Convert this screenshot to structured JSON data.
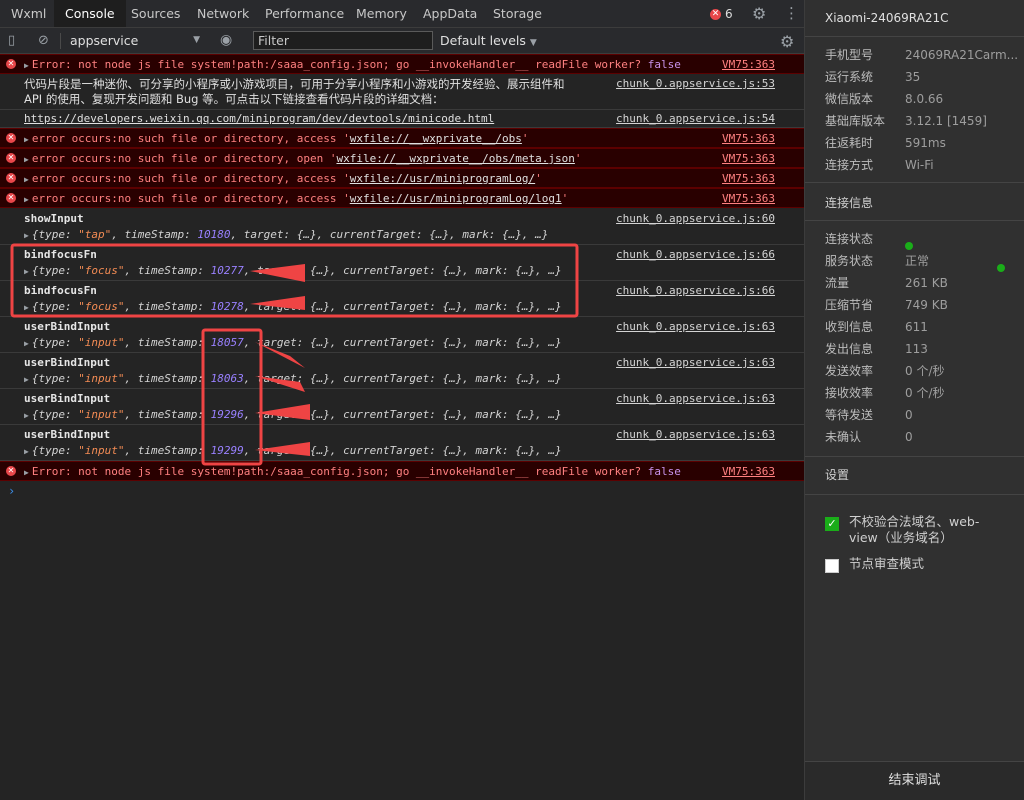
{
  "tabs": [
    "Wxml",
    "Console",
    "Sources",
    "Network",
    "Performance",
    "Memory",
    "AppData",
    "Storage"
  ],
  "error_count": "6",
  "toolbar": {
    "context": "appservice",
    "filter_placeholder": "Filter",
    "levels": "Default levels"
  },
  "logs": {
    "r0": {
      "text": "Error: not node js file system!path:/saaa_config.json; go __invokeHandler__ readFile worker?",
      "val": "false",
      "src": "VM75:363"
    },
    "r1": {
      "line1": "代码片段是一种迷你、可分享的小程序或小游戏项目，可用于分享小程序和小游戏的开发经验、展示组件和",
      "line2": "API 的使用、复现开发问题和 Bug 等。可点击以下链接查看代码片段的详细文档：",
      "src": "chunk_0.appservice.js:53"
    },
    "r2": {
      "link": "https://developers.weixin.qq.com/miniprogram/dev/devtools/minicode.html",
      "src": "chunk_0.appservice.js:54"
    },
    "r3": {
      "pre": "error occurs:no such file or directory, access '",
      "path": "wxfile://__wxprivate__/obs",
      "post": "'",
      "src": "VM75:363"
    },
    "r4": {
      "pre": "error occurs:no such file or directory, open '",
      "path": "wxfile://__wxprivate__/obs/meta.json",
      "post": "'",
      "src": "VM75:363"
    },
    "r5": {
      "pre": "error occurs:no such file or directory, access '",
      "path": "wxfile://usr/miniprogramLog/",
      "post": "'",
      "src": "VM75:363"
    },
    "r6": {
      "pre": "error occurs:no such file or directory, access '",
      "path": "wxfile://usr/miniprogramLog/log1",
      "post": "'",
      "src": "VM75:363"
    },
    "r7": {
      "label": "showInput",
      "type": "\"tap\"",
      "ts": "10180",
      "src": "chunk_0.appservice.js:60"
    },
    "r8": {
      "label": "bindfocusFn",
      "type": "\"focus\"",
      "ts": "10277",
      "src": "chunk_0.appservice.js:66"
    },
    "r9": {
      "label": "bindfocusFn",
      "type": "\"focus\"",
      "ts": "10278",
      "src": "chunk_0.appservice.js:66"
    },
    "r10": {
      "label": "userBindInput",
      "type": "\"input\"",
      "ts": "18057",
      "src": "chunk_0.appservice.js:63"
    },
    "r11": {
      "label": "userBindInput",
      "type": "\"input\"",
      "ts": "18063",
      "src": "chunk_0.appservice.js:63"
    },
    "r12": {
      "label": "userBindInput",
      "type": "\"input\"",
      "ts": "19296",
      "src": "chunk_0.appservice.js:63"
    },
    "r13": {
      "label": "userBindInput",
      "type": "\"input\"",
      "ts": "19299",
      "src": "chunk_0.appservice.js:63"
    },
    "r14": {
      "text": "Error: not node js file system!path:/saaa_config.json; go __invokeHandler__ readFile worker?",
      "val": "false",
      "src": "VM75:363"
    }
  },
  "obj_parts": {
    "open": "{type: ",
    "ts_key": ", timeStamp: ",
    "rest": ", target: {…}, currentTarget: {…}, mark: {…}, …}"
  },
  "prompt": "›",
  "panel": {
    "device": "Xiaomi-24069RA21C",
    "info": [
      {
        "k": "手机型号",
        "v": "24069RA21Carm..."
      },
      {
        "k": "运行系统",
        "v": "35"
      },
      {
        "k": "微信版本",
        "v": "8.0.66"
      },
      {
        "k": "基础库版本",
        "v": "3.12.1 [1459]"
      },
      {
        "k": "往返耗时",
        "v": "591ms"
      },
      {
        "k": "连接方式",
        "v": "Wi-Fi"
      }
    ],
    "conn_title": "连接信息",
    "conn": [
      {
        "k": "连接状态",
        "v": ""
      },
      {
        "k": "服务状态",
        "v": "正常"
      },
      {
        "k": "流量",
        "v": "261 KB"
      },
      {
        "k": "压缩节省",
        "v": "749 KB"
      },
      {
        "k": "收到信息",
        "v": "611"
      },
      {
        "k": "发出信息",
        "v": "113"
      },
      {
        "k": "发送效率",
        "v": "0 个/秒"
      },
      {
        "k": "接收效率",
        "v": "0 个/秒"
      },
      {
        "k": "等待发送",
        "v": "0"
      },
      {
        "k": "未确认",
        "v": "0"
      }
    ],
    "settings_title": "设置",
    "opt1": "不校验合法域名、web-view（业务域名）",
    "opt2": "节点审查模式",
    "stop": "结束调试"
  },
  "colors": {
    "annotation": "#ef4444",
    "status_ok": "#1aad19",
    "error_bg": "#290000"
  }
}
